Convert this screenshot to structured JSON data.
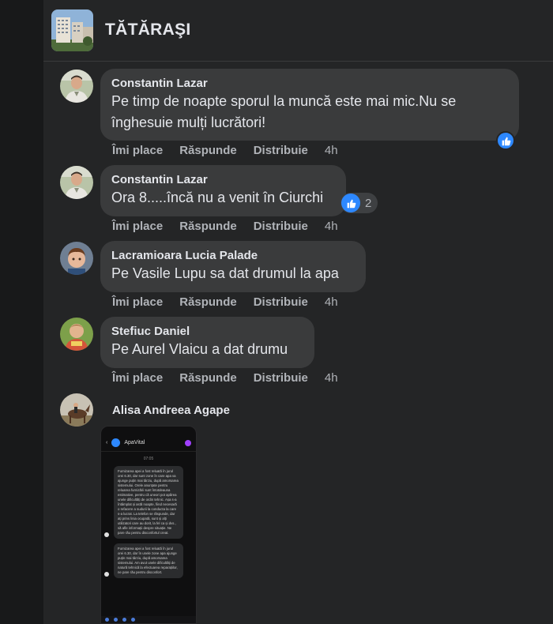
{
  "group": {
    "name": "TĂTĂRAŞI"
  },
  "actions": {
    "like": "Îmi place",
    "reply": "Răspunde",
    "share": "Distribuie"
  },
  "comments": [
    {
      "author": "Constantin Lazar",
      "text_line1": "Pe timp de noapte sporul la muncă este mai mic.Nu se",
      "text_line2": "înghesuie mulți lucrători!",
      "time": "4h",
      "reaction": "like"
    },
    {
      "author": "Constantin Lazar",
      "text": "Ora 8.....încă nu a venit în Ciurchi",
      "time": "4h",
      "reaction": "like",
      "reaction_count": "2"
    },
    {
      "author": "Lacramioara Lucia Palade",
      "text": "Pe Vasile Lupu sa dat drumul la apa",
      "time": "4h"
    },
    {
      "author": "Stefiuc Daniel",
      "text": "Pe Aurel Vlaicu a dat drumu",
      "time": "4h"
    },
    {
      "author": "Alisa Andreea Agape",
      "attachment": {
        "app_name": "ApaVital",
        "time_label": "07:05",
        "message1": "Furnizarea apei a fost reluată în jurul orei 6.30, dar sunt zone în care apa va ajunge puțin mai târziu, după amorsarea sistemului. Orele anunțate pentru reluarea furnizării sunt întotdeauna estimative, pentru că uneori pot apărea unele dificultăți de ordin tehnic. Așa s-a întâmplat și astă noapte, fiind necesară o refacere a sudurii la conducta la care s-a lucrat. La telefon se răspunde, dar ați prins linia ocupată, sunt și alți utilizatori care au dorit, la fel ca și dvs., să afle informații despre situație. Ne pare rău pentru disconfortul creat.",
        "message2": "Furnizarea apei a fost reluată în jurul orei 6.30, dar în unele zone apa ajunge puțin mai târziu, după amorsarea sistemului. Am avut unele dificultăți de natură tehnică la efectuarea reparațiilor, ne pare rău pentru disconfort."
      }
    }
  ]
}
